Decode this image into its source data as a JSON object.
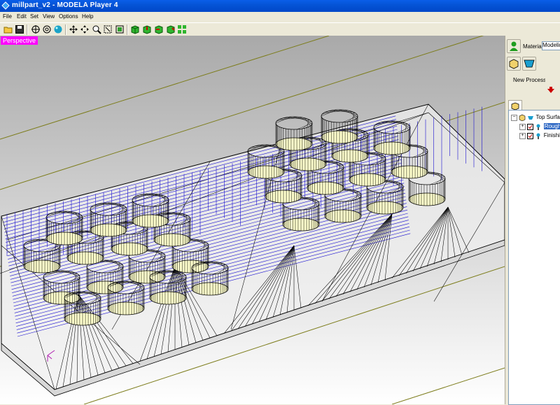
{
  "window": {
    "title": "millpart_v2 - MODELA Player 4"
  },
  "menu": {
    "items": [
      "File",
      "Edit",
      "Set",
      "View",
      "Options",
      "Help"
    ]
  },
  "toolbar": {
    "buttons": [
      "open-icon",
      "save-icon",
      "view-rotate-icon",
      "view-fit-icon",
      "sphere-icon",
      "pan-icon",
      "move-icon",
      "zoom-icon",
      "zoom-window-icon",
      "zoom-fit-icon",
      "view-front-icon",
      "view-top-icon",
      "view-right-icon",
      "view-iso-icon",
      "multi-view-icon"
    ]
  },
  "viewport": {
    "view_label": "Perspective",
    "background_top": "#a9a9a9",
    "background_bottom": "#ffffff",
    "toolpath_color": "#0000cc",
    "mesh_color": "#000000"
  },
  "panel": {
    "material_label": "Material",
    "material_value": "Modeling",
    "new_process_label": "New Process",
    "tree": {
      "root": "Top Surface",
      "children": [
        "Roughing",
        "Finishing"
      ]
    }
  },
  "colors": {
    "titlebar": "#0054e3",
    "selected": "#316ac5",
    "perspective_badge": "#ff00ff",
    "arrow": "#cc0000"
  }
}
